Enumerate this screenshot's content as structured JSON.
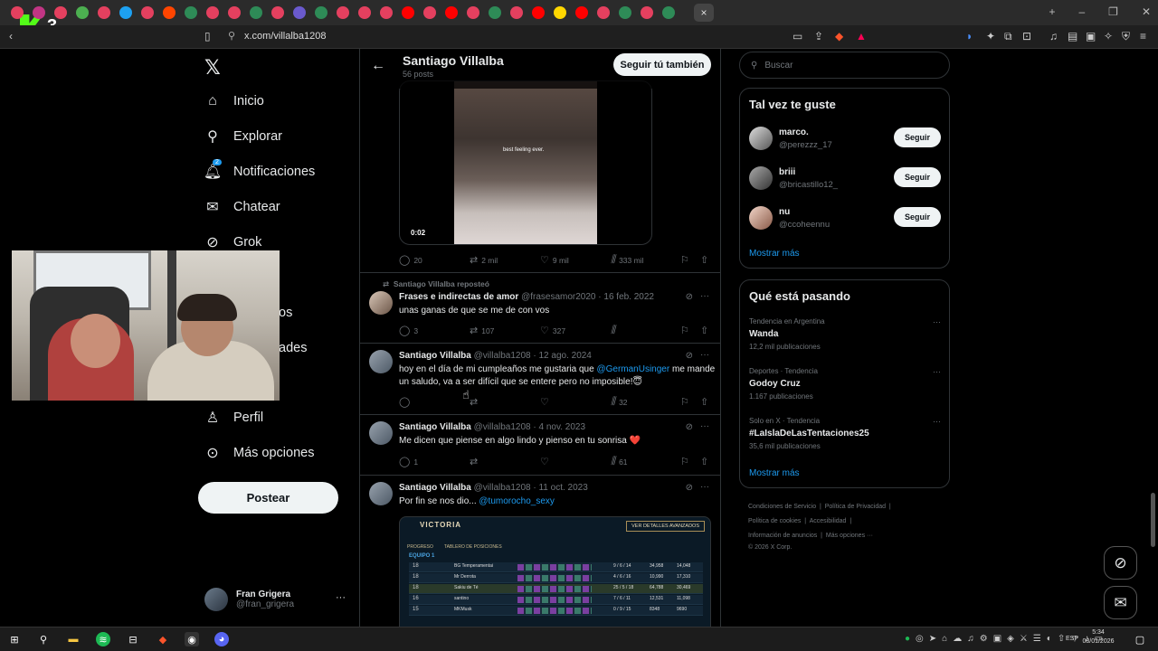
{
  "browser": {
    "url": "x.com/villalba1208",
    "active_tab_close": "×",
    "tab_colors": [
      "#e4405f",
      "#c13584",
      "#e4405f",
      "#4caf50",
      "#e4405f",
      "#1da1f2",
      "#e4405f",
      "#ff4500",
      "#2e8b57",
      "#e4405f",
      "#e4405f",
      "#2e8b57",
      "#e4405f",
      "#6a5acd",
      "#2e8b57",
      "#e4405f",
      "#e4405f",
      "#e4405f",
      "#ff0000",
      "#e4405f",
      "#ff0000",
      "#e4405f",
      "#2e8b57",
      "#e4405f",
      "#ff0000",
      "#ffd700",
      "#ff0000",
      "#e4405f",
      "#2e8b57",
      "#e4405f",
      "#2e8b57"
    ]
  },
  "nav": {
    "logo": "𝕏",
    "items": [
      {
        "label": "Inicio",
        "icon": "home-icon"
      },
      {
        "label": "Explorar",
        "icon": "search-icon"
      },
      {
        "label": "Notificaciones",
        "icon": "bell-icon",
        "badge": "2"
      },
      {
        "label": "Chatear",
        "icon": "mail-icon"
      },
      {
        "label": "Grok",
        "icon": "grok-icon"
      },
      {
        "label": "Perfil",
        "icon": "person-icon"
      },
      {
        "label": "Más opciones",
        "icon": "more-circle-icon"
      }
    ],
    "partial_1": "os",
    "partial_2": "ades",
    "post_button": "Postear",
    "account": {
      "name": "Fran Grigera",
      "handle": "@fran_grigera"
    }
  },
  "profile": {
    "name": "Santiago Villalba",
    "posts_count": "56 posts",
    "follow_button": "Seguir tú también"
  },
  "video": {
    "caption": "best feeling ever.",
    "duration": "0:02"
  },
  "video_actions": {
    "replies": "20",
    "reposts": "2 mil",
    "likes": "9 mil",
    "views": "333 mil"
  },
  "tweets": [
    {
      "repost_label": "Santiago Villalba reposteó",
      "name": "Frases e indirectas de amor",
      "handle": "@frasesamor2020",
      "date": "· 16 feb. 2022",
      "text": "unas ganas de que se me de con vos",
      "replies": "3",
      "reposts": "107",
      "likes": "327",
      "views": ""
    },
    {
      "name": "Santiago Villalba",
      "handle": "@villalba1208",
      "date": "· 12 ago. 2024",
      "text_1": "hoy en el día de mi cumpleaños me gustaria que",
      "mention": "@GermanUsinger",
      "text_2": "me mande",
      "text_3": "un saludo, va a ser difícil que se entere pero no imposible!😇",
      "replies": "",
      "reposts": "",
      "likes": "",
      "views": "32"
    },
    {
      "name": "Santiago Villalba",
      "handle": "@villalba1208",
      "date": "· 4 nov. 2023",
      "text": "Me dicen que piense en algo lindo y pienso en tu sonrisa ❤️",
      "replies": "1",
      "reposts": "",
      "likes": "",
      "views": "61"
    },
    {
      "name": "Santiago Villalba",
      "handle": "@villalba1208",
      "date": "· 11 oct. 2023",
      "text": "Por fin se nos dio...",
      "mention": "@tumorocho_sexy"
    }
  ],
  "game_card": {
    "title": "VICTORIA",
    "button": "VER DETALLES AVANZADOS",
    "tab_1": "PROGRESO",
    "tab_2": "TABLERO DE POSICIONES",
    "team": "EQUIPO 1",
    "rows": [
      {
        "lvl": "18",
        "name": "BG Temperamentai",
        "kda": "9 / 6 / 14",
        "dmg": "34,958",
        "gold": "14,048"
      },
      {
        "lvl": "18",
        "name": "Mr Derrota",
        "kda": "4 / 6 / 16",
        "dmg": "10,990",
        "gold": "17,310"
      },
      {
        "lvl": "18",
        "name": "Sakiu de Té",
        "kda": "25 / 5 / 18",
        "dmg": "64,788",
        "gold": "30,469"
      },
      {
        "lvl": "16",
        "name": "santino",
        "kda": "7 / 6 / 11",
        "dmg": "12,531",
        "gold": "11,098"
      },
      {
        "lvl": "15",
        "name": "MKMusk",
        "kda": "0 / 9 / 15",
        "dmg": "8348",
        "gold": "9690"
      }
    ]
  },
  "search": {
    "placeholder": "Buscar"
  },
  "suggestions": {
    "title": "Tal vez te guste",
    "follow_label": "Seguir",
    "people": [
      {
        "name": "marco.",
        "handle": "@perezzz_17"
      },
      {
        "name": "briii",
        "handle": "@bricastillo12_"
      },
      {
        "name": "nu",
        "handle": "@ccoheennu"
      }
    ],
    "show_more": "Mostrar más"
  },
  "trends": {
    "title": "Qué está pasando",
    "items": [
      {
        "context": "Tendencia en Argentina",
        "topic": "Wanda",
        "posts": "12,2 mil publicaciones"
      },
      {
        "context": "Deportes · Tendencia",
        "topic": "Godoy Cruz",
        "posts": "1.167 publicaciones"
      },
      {
        "context": "Solo en X · Tendencia",
        "topic": "#LaIslaDeLasTentaciones25",
        "posts": "35,6 mil publicaciones"
      }
    ],
    "show_more": "Mostrar más"
  },
  "footer": {
    "l1a": "Condiciones de Servicio",
    "l1b": "Política de Privacidad",
    "l2a": "Política de cookies",
    "l2b": "Accesibilidad",
    "l3a": "Información de anuncios",
    "l3b": "Más opciones ···",
    "copyright": "© 2026 X Corp."
  },
  "taskbar": {
    "lang": "ESP",
    "time": "5:34",
    "date": "08/01/2026"
  }
}
